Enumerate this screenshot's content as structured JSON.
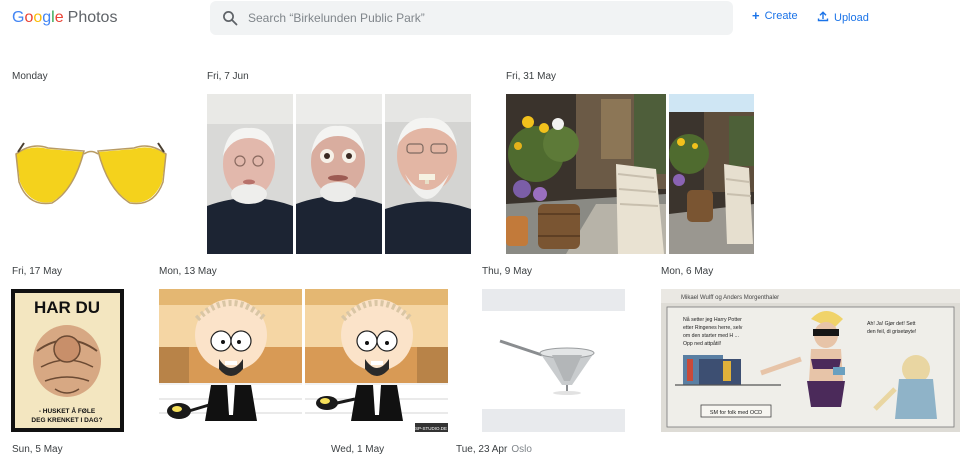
{
  "header": {
    "logo_letters": [
      "G",
      "o",
      "o",
      "g",
      "l",
      "e"
    ],
    "product": "Photos",
    "search_placeholder": "Search “Birkelunden Public Park”",
    "create_label": "Create",
    "upload_label": "Upload"
  },
  "groups": [
    {
      "date": "Monday",
      "location": ""
    },
    {
      "date": "Fri, 7 Jun",
      "location": ""
    },
    {
      "date": "Fri, 31 May",
      "location": ""
    },
    {
      "date": "Fri, 17 May",
      "location": ""
    },
    {
      "date": "Mon, 13 May",
      "location": ""
    },
    {
      "date": "Thu, 9 May",
      "location": ""
    },
    {
      "date": "Mon, 6 May",
      "location": ""
    },
    {
      "date": "Sun, 5 May",
      "location": ""
    },
    {
      "date": "Wed, 1 May",
      "location": ""
    },
    {
      "date": "Tue, 23 Apr",
      "location": "Oslo"
    }
  ],
  "photo_text": {
    "poster_line1": "HAR DU",
    "poster_line2": "- HUSKET Å FØLE",
    "poster_line3": "DEG KRENKET I DAG?",
    "comic_header": "Mikael Wulff og Anders Morgenthaler",
    "comic_bubble1_l1": "Nå setter jeg Harry Potter",
    "comic_bubble1_l2": "etter Ringenes herre, selv",
    "comic_bubble1_l3": "om den starter med H ...",
    "comic_bubble1_l4": "Opp ned attpåtil!",
    "comic_bubble2_l1": "Ah! Ja! Gjør det! Sett",
    "comic_bubble2_l2": "den feil, di grisetøyte!",
    "comic_sign": "SM for folk med OCD",
    "sp_watermark": "SP-STUDIO.DE"
  },
  "colors": {
    "accent": "#1a73e8",
    "search_bg": "#f1f3f4",
    "glasses_lens": "#f4d21c"
  }
}
